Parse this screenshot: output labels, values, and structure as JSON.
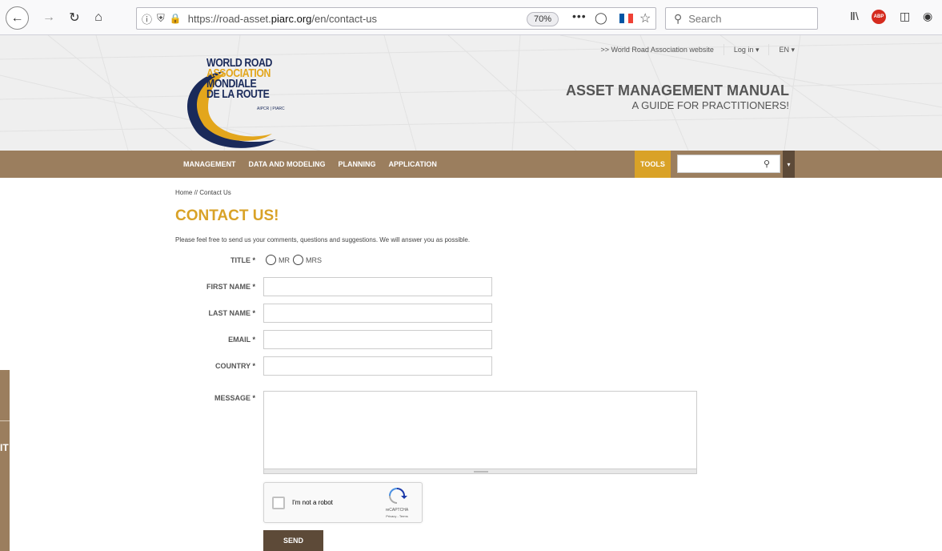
{
  "browser": {
    "url_prefix": "https://road-asset.",
    "url_domain": "piarc.org",
    "url_path": "/en/contact-us",
    "zoom": "70%",
    "more_label": "•••",
    "search_placeholder": "Search",
    "abp_label": "ABP",
    "icons": [
      "back-icon",
      "forward-icon",
      "reload-icon",
      "home-icon",
      "info-icon",
      "tracking-shield-icon",
      "lock-icon",
      "pocket-icon",
      "bookmark-star-icon",
      "search-icon",
      "library-icon",
      "adblock-icon",
      "sidebar-icon",
      "extension-icon"
    ]
  },
  "header": {
    "logo_lines": [
      "WORLD ROAD",
      "ASSOCIATION",
      "MONDIALE",
      "DE LA ROUTE"
    ],
    "logo_sub": "AIPCR | PIARC",
    "top_links": [
      ">> World Road Association website",
      "Log in ▾",
      "EN ▾"
    ],
    "manual_title": "ASSET MANAGEMENT MANUAL",
    "manual_subtitle": "A GUIDE FOR PRACTITIONERS!"
  },
  "menu": {
    "items": [
      "MANAGEMENT",
      "DATA AND MODELING",
      "PLANNING",
      "APPLICATION"
    ],
    "tools": "TOOLS",
    "dropdown": "▾"
  },
  "side_tab": {
    "text": "IT"
  },
  "page": {
    "breadcrumb": "Home // Contact Us",
    "title": "CONTACT US!",
    "intro": "Please feel free to send us your comments, questions and suggestions. We will answer you as possible."
  },
  "form": {
    "title_label": "TITLE",
    "required_mark": "*",
    "title_options": [
      "MR",
      "MRS"
    ],
    "first_name_label": "FIRST NAME",
    "last_name_label": "LAST NAME",
    "email_label": "EMAIL",
    "country_label": "COUNTRY",
    "message_label": "MESSAGE",
    "first_name_value": "",
    "last_name_value": "",
    "email_value": "",
    "country_value": "",
    "message_value": "",
    "captcha_label": "I'm not a robot",
    "captcha_brand": "reCAPTCHA",
    "captcha_terms": "Privacy - Terms",
    "send_label": "SEND"
  },
  "colors": {
    "menu_bg": "#9b7e5e",
    "accent_gold": "#d9a227",
    "dark_brown": "#5d4a38",
    "logo_navy": "#1a2a5a"
  }
}
